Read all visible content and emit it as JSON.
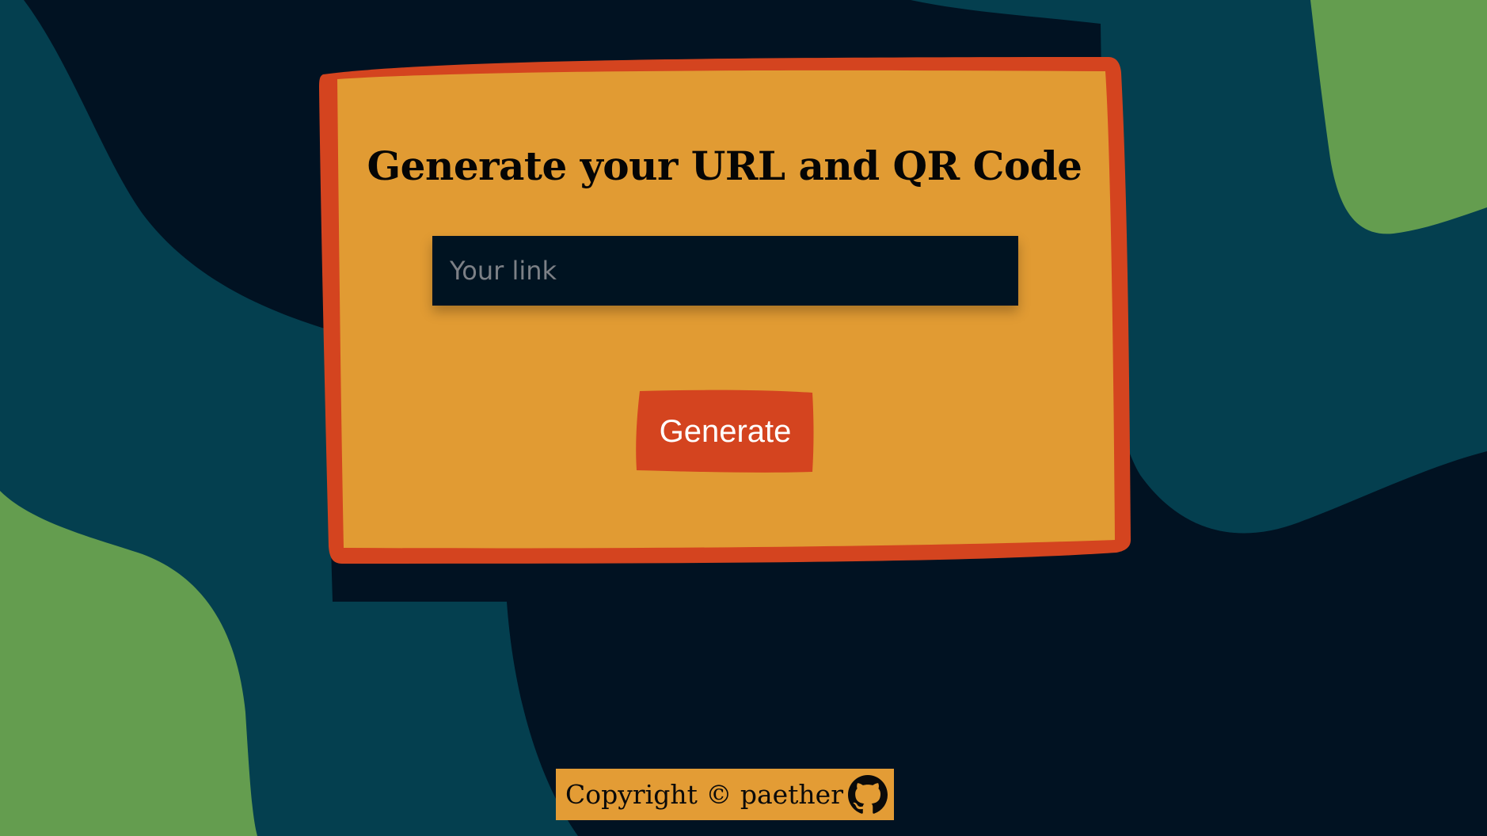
{
  "colors": {
    "background_dark": "#011222",
    "wave_teal": "#043f4f",
    "wave_green": "#649d4f",
    "card_fill": "#e19b33",
    "card_border": "#d4441f",
    "button_fill": "#d4441f",
    "input_fill": "#001321"
  },
  "card": {
    "title": "Generate your URL and QR Code",
    "input_placeholder": "Your link",
    "input_value": "",
    "button_label": "Generate"
  },
  "footer": {
    "copyright": "Copyright © paether",
    "github_icon": "github-icon"
  }
}
